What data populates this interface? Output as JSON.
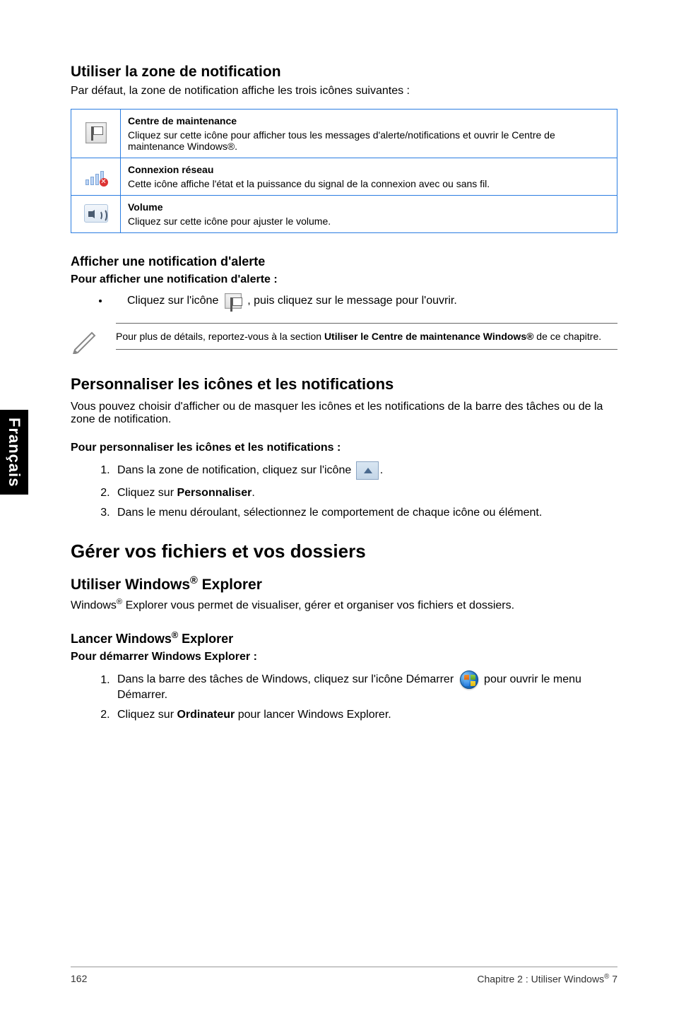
{
  "sidetab": "Français",
  "section1": {
    "title": "Utiliser la zone de notification",
    "lead": "Par défaut, la zone de notification affiche les trois icônes suivantes :"
  },
  "table": {
    "rows": [
      {
        "icon": "action-center-icon",
        "title": "Centre de maintenance",
        "desc": "Cliquez sur cette icône pour afficher tous les messages d'alerte/notifications et ouvrir le Centre de maintenance Windows®."
      },
      {
        "icon": "network-icon",
        "title": "Connexion réseau",
        "desc": "Cette icône affiche l'état et la puissance du signal de la connexion avec ou sans fil."
      },
      {
        "icon": "volume-icon",
        "title": "Volume",
        "desc": "Cliquez sur cette icône pour ajuster le volume."
      }
    ]
  },
  "alert": {
    "heading": "Afficher une notification d'alerte",
    "sub": "Pour afficher une notification d'alerte :",
    "bullet_pre": "Cliquez sur l'icône ",
    "bullet_post": ", puis cliquez sur le message pour l'ouvrir."
  },
  "note": {
    "pre": "Pour plus de détails, reportez-vous à la section ",
    "bold": "Utiliser le Centre de maintenance Windows®",
    "post": " de ce chapitre."
  },
  "personalize": {
    "title": "Personnaliser les icônes et les notifications",
    "lead": "Vous pouvez choisir d'afficher ou de masquer les icônes et les notifications de la barre des tâches ou de la zone de notification.",
    "sub": "Pour personnaliser les icônes et les notifications :",
    "steps": [
      {
        "pre": "Dans la zone de notification, cliquez sur l'icône ",
        "post": ".",
        "icon": "tray"
      },
      {
        "pre": "Cliquez sur ",
        "bold": "Personnaliser",
        "post": "."
      },
      {
        "pre": "Dans le menu déroulant, sélectionnez le comportement de chaque icône ou élément."
      }
    ]
  },
  "h1": "Gérer vos fichiers et vos dossiers",
  "explorer": {
    "title_pre": "Utiliser Windows",
    "title_post": " Explorer",
    "lead_pre": "Windows",
    "lead_post": " Explorer vous permet de visualiser, gérer et organiser vos fichiers et dossiers."
  },
  "launch": {
    "title_pre": "Lancer Windows",
    "title_post": " Explorer",
    "sub": "Pour démarrer Windows Explorer :",
    "steps": [
      {
        "pre": "Dans la barre des tâches de Windows, cliquez sur l'icône Démarrer ",
        "post": " pour ouvrir le menu Démarrer.",
        "icon": "start"
      },
      {
        "pre": "Cliquez sur ",
        "bold": "Ordinateur",
        "post": " pour lancer Windows Explorer."
      }
    ]
  },
  "footer": {
    "page": "162",
    "chapter_pre": "Chapitre 2 : Utiliser Windows",
    "chapter_post": " 7"
  }
}
